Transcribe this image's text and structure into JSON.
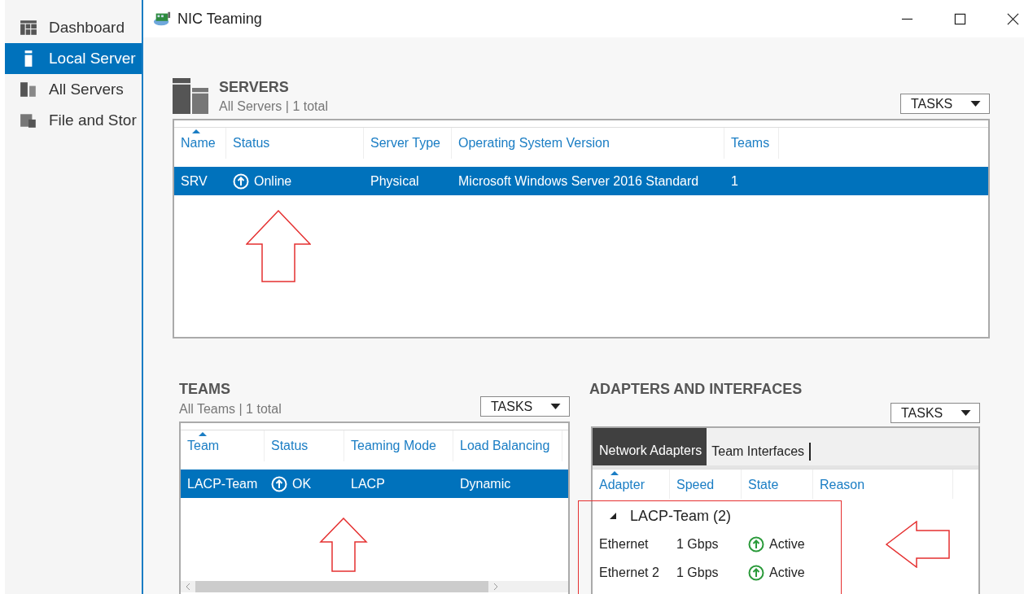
{
  "sidebar": {
    "items": [
      {
        "label": "Dashboard",
        "kind": "dashboard",
        "selected": false
      },
      {
        "label": "Local Server",
        "kind": "local",
        "selected": true
      },
      {
        "label": "All Servers",
        "kind": "servers",
        "selected": false
      },
      {
        "label": "File and Stor",
        "kind": "storage",
        "selected": false
      }
    ]
  },
  "window": {
    "title": "NIC Teaming"
  },
  "servers": {
    "title": "SERVERS",
    "subtitle": "All Servers | 1 total",
    "tasks": "TASKS",
    "annotation": {
      "kind": "up_arrow"
    },
    "columns": [
      {
        "label": "Name",
        "sorted": true
      },
      {
        "label": "Status",
        "sorted": false
      },
      {
        "label": "Server Type",
        "sorted": false
      },
      {
        "label": "Operating System Version",
        "sorted": false
      },
      {
        "label": "Teams",
        "sorted": false
      }
    ],
    "rows": [
      {
        "selected": true,
        "cells": [
          {
            "text": "SRV"
          },
          {
            "text": "Online",
            "kind": "status_up"
          },
          {
            "text": "Physical"
          },
          {
            "text": "Microsoft Windows Server 2016 Standard"
          },
          {
            "text": "1"
          }
        ]
      }
    ]
  },
  "teams": {
    "title": "TEAMS",
    "subtitle": "All Teams | 1 total",
    "tasks": "TASKS",
    "annotation": {
      "kind": "up_arrow"
    },
    "columns": [
      {
        "label": "Team",
        "sorted": true
      },
      {
        "label": "Status",
        "sorted": false
      },
      {
        "label": "Teaming Mode",
        "sorted": false
      },
      {
        "label": "Load Balancing",
        "sorted": false
      }
    ],
    "rows": [
      {
        "selected": true,
        "cells": [
          {
            "text": "LACP-Team"
          },
          {
            "text": "OK",
            "kind": "status_up"
          },
          {
            "text": "LACP"
          },
          {
            "text": "Dynamic"
          }
        ]
      }
    ]
  },
  "adapters": {
    "title": "ADAPTERS AND INTERFACES",
    "tasks": "TASKS",
    "annotation": {
      "kind": "highlight_with_arrow"
    },
    "tabs": [
      {
        "label": "Network Adapters",
        "selected": true
      },
      {
        "label": "Team Interfaces",
        "selected": false
      }
    ],
    "columns": [
      {
        "label": "Adapter",
        "sorted": true
      },
      {
        "label": "Speed",
        "sorted": false
      },
      {
        "label": "State",
        "sorted": false
      },
      {
        "label": "Reason",
        "sorted": false
      }
    ],
    "groups": [
      {
        "label": "LACP-Team (2)",
        "expanded": true,
        "children": [
          {
            "cells": [
              {
                "text": "Ethernet"
              },
              {
                "text": "1 Gbps"
              },
              {
                "text": "Active",
                "kind": "status_up"
              }
            ]
          },
          {
            "cells": [
              {
                "text": "Ethernet 2"
              },
              {
                "text": "1 Gbps"
              },
              {
                "text": "Active",
                "kind": "status_up"
              }
            ]
          }
        ]
      }
    ]
  }
}
